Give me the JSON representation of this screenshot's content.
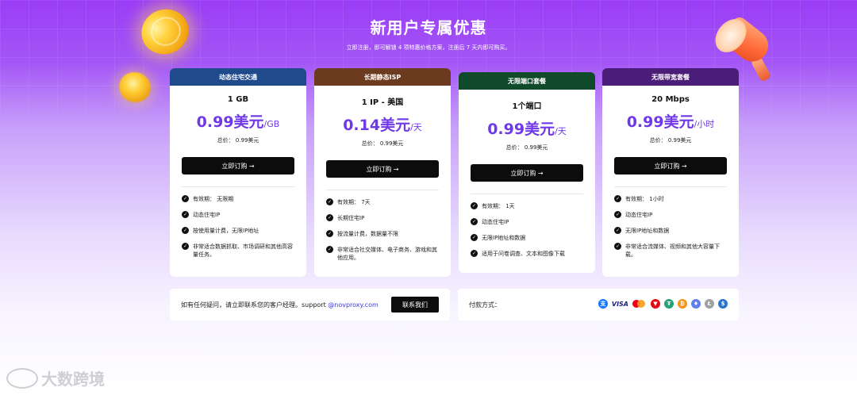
{
  "hero": {
    "title": "新用户专属优惠",
    "subtitle": "立即注册，即可解锁 4 项特惠价格方案，注册后 7 天内即可购买。"
  },
  "plans": [
    {
      "tab": "动态住宅交通",
      "tab_color": "#1f4a8c",
      "name": "1 GB",
      "price": "0.99美元",
      "unit": "/GB",
      "total": "总价：  0.99美元",
      "button": "立即订购 →",
      "features": [
        "有效期：  无限期",
        "动态住宅IP",
        "按使用量计费，无限IP地址",
        "非常适合数据抓取、市场调研和其他高容量任务。"
      ]
    },
    {
      "tab": "长期静态ISP",
      "tab_color": "#6b3a1f",
      "name": "1 IP - 美国",
      "price": "0.14美元",
      "unit": "/天",
      "total": "总价：  0.99美元",
      "button": "立即订购 →",
      "features": [
        "有效期：  7天",
        "长期住宅IP",
        "按流量计费，数据量不限",
        "非常适合社交媒体、电子商务、游戏和其他应用。"
      ]
    },
    {
      "tab": "无限端口套餐",
      "tab_color": "#0f4a2a",
      "name": "1个端口",
      "price": "0.99美元",
      "unit": "/天",
      "total": "总价：  0.99美元",
      "button": "立即订购 →",
      "features": [
        "有效期：  1天",
        "动态住宅IP",
        "无限IP地址和数据",
        "适用于问卷调查、文本和图像下载"
      ]
    },
    {
      "tab": "无限带宽套餐",
      "tab_color": "#4a1d78",
      "name": "20 Mbps",
      "price": "0.99美元",
      "unit": "/小时",
      "total": "总价：  0.99美元",
      "button": "立即订购 →",
      "features": [
        "有效期：  1小时",
        "动态住宅IP",
        "无限IP地址和数据",
        "非常适合流媒体、视频和其他大容量下载。"
      ]
    }
  ],
  "contact": {
    "text": "如有任何疑问，请立即联系您的客户经理。support ",
    "email": "@novproxy.com",
    "button": "联系我们"
  },
  "payment": {
    "label": "付款方式：",
    "icons": [
      {
        "name": "alipay-icon",
        "glyph": "支",
        "color": "#1677ff"
      },
      {
        "name": "visa-icon",
        "glyph": "VISA",
        "color": "#1a1f71"
      },
      {
        "name": "mastercard-icon",
        "glyph": "",
        "color": "#eb001b"
      },
      {
        "name": "tron-icon",
        "glyph": "▼",
        "color": "#e50914"
      },
      {
        "name": "tether-icon",
        "glyph": "₮",
        "color": "#26a17b"
      },
      {
        "name": "bitcoin-icon",
        "glyph": "₿",
        "color": "#f7931a"
      },
      {
        "name": "ethereum-icon",
        "glyph": "♦",
        "color": "#627eea"
      },
      {
        "name": "litecoin-icon",
        "glyph": "Ł",
        "color": "#a0a0a0"
      },
      {
        "name": "usdc-icon",
        "glyph": "$",
        "color": "#2775ca"
      }
    ]
  },
  "watermark": "大数跨境"
}
